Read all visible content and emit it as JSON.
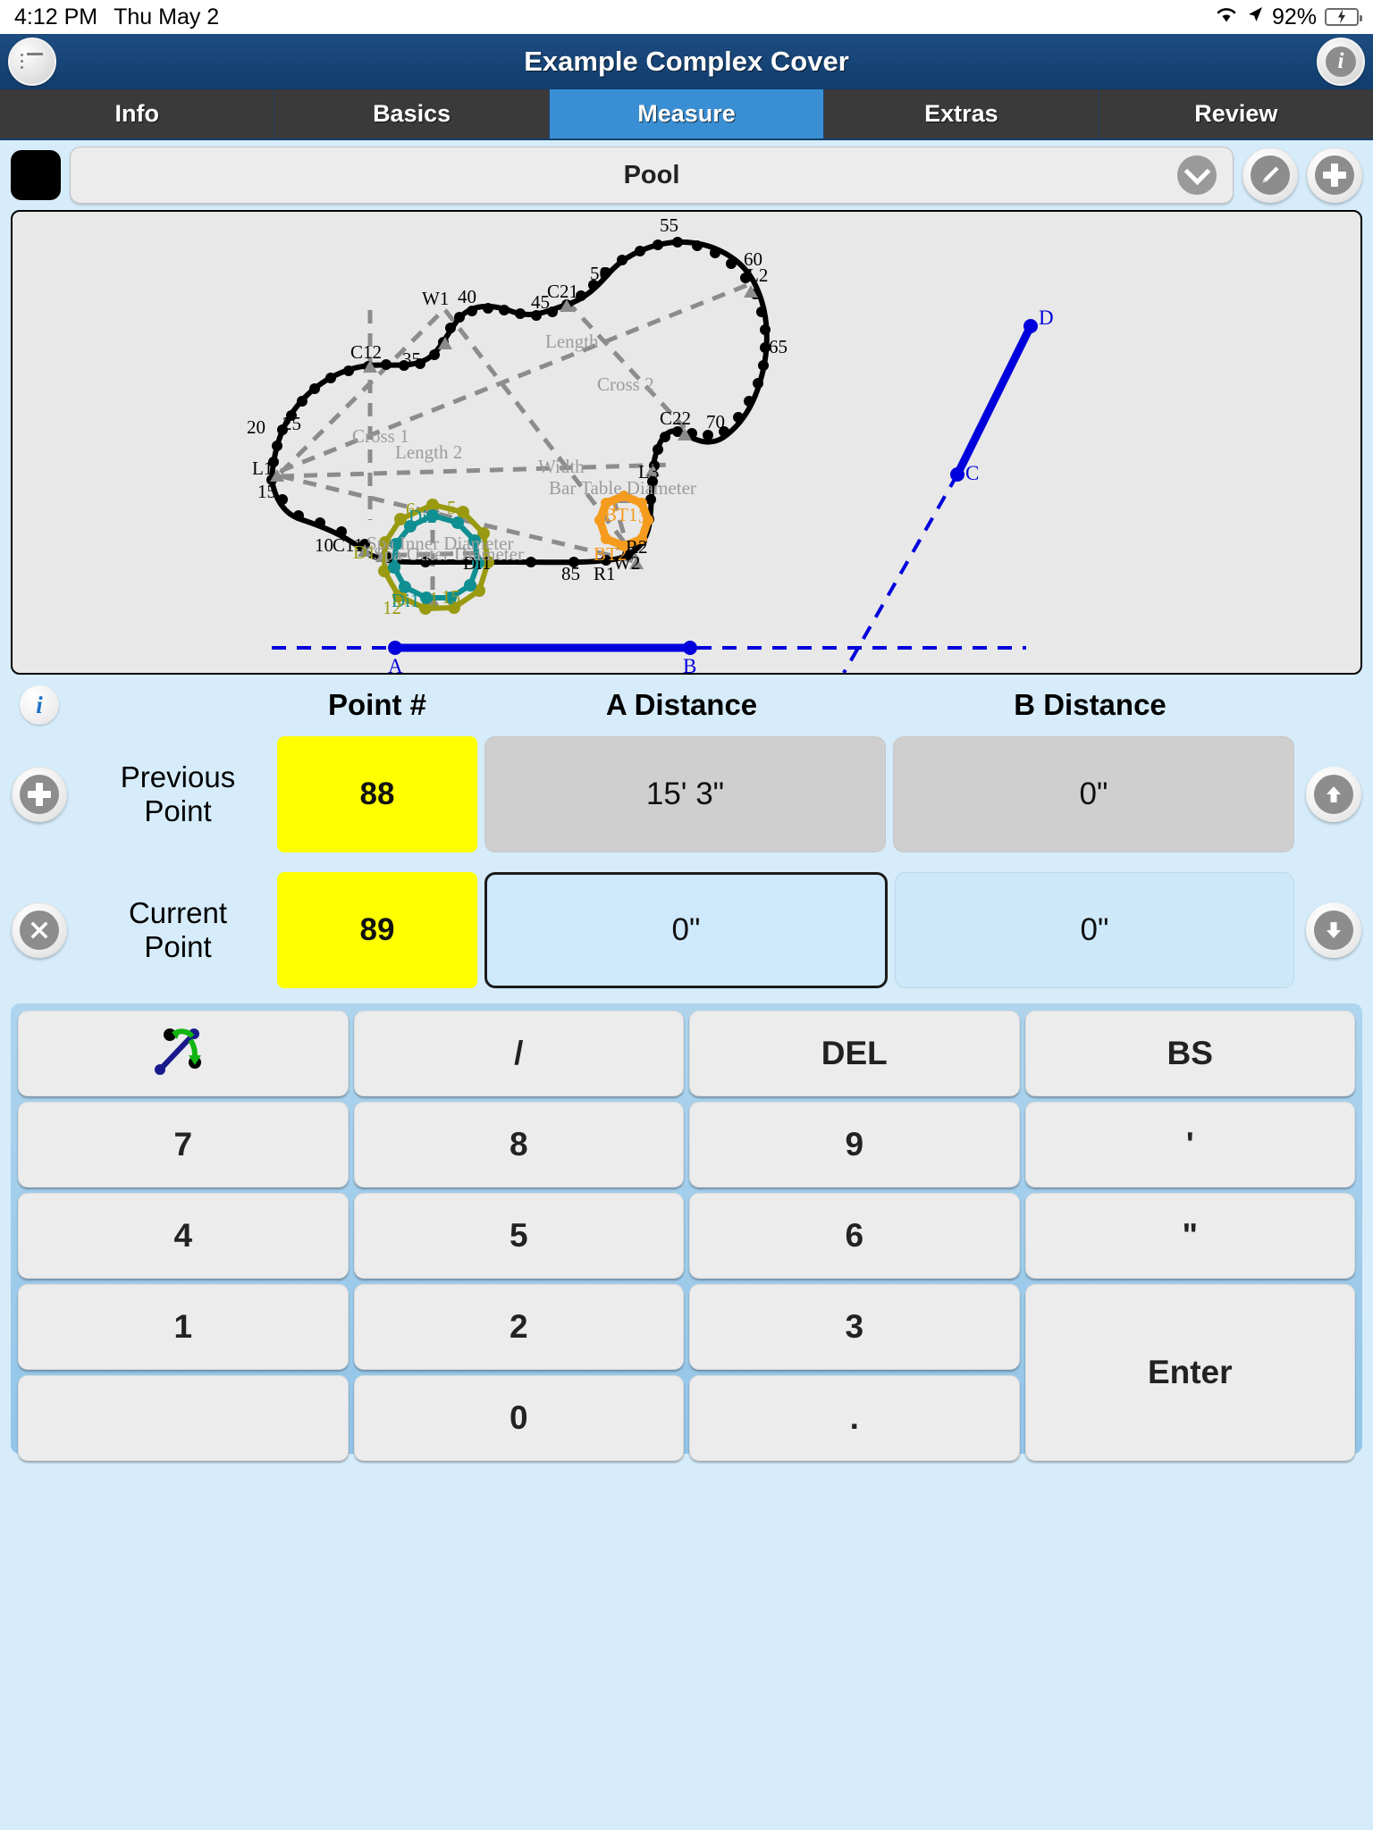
{
  "statusbar": {
    "time": "4:12 PM",
    "date": "Thu May 2",
    "battery_percent": "92%",
    "wifi_icon": "wifi-icon",
    "location_icon": "location-arrow-icon",
    "battery_icon": "battery-charging-icon"
  },
  "titlebar": {
    "title": "Example Complex Cover",
    "menu_icon": "list-menu-icon",
    "info_icon": "info-icon"
  },
  "tabs": [
    {
      "label": "Info",
      "active": false
    },
    {
      "label": "Basics",
      "active": false
    },
    {
      "label": "Measure",
      "active": true
    },
    {
      "label": "Extras",
      "active": false
    },
    {
      "label": "Review",
      "active": false
    }
  ],
  "selector": {
    "color_swatch": "#000000",
    "current_shape": "Pool",
    "chevron_icon": "chevron-down-icon",
    "edit_icon": "pencil-icon",
    "add_icon": "plus-icon"
  },
  "entry": {
    "info_icon": "info-icon",
    "add_icon": "plus-icon",
    "delete_icon": "close-x-icon",
    "up_icon": "arrow-up-icon",
    "down_icon": "arrow-down-icon",
    "columns": {
      "point": "Point #",
      "a": "A Distance",
      "b": "B Distance"
    },
    "rows": [
      {
        "label": "Previous\nPoint",
        "label_line1": "Previous",
        "label_line2": "Point",
        "point": "88",
        "a": "15' 3\"",
        "b": "0\"",
        "state": "readonly"
      },
      {
        "label": "Current\nPoint",
        "label_line1": "Current",
        "label_line2": "Point",
        "point": "89",
        "a": "0\"",
        "b": "0\"",
        "state": "editable"
      }
    ]
  },
  "keypad": [
    {
      "label": "",
      "name": "swap-points-button",
      "icon": "swap-arrows-icon"
    },
    {
      "label": "/",
      "name": "key-slash"
    },
    {
      "label": "DEL",
      "name": "key-del"
    },
    {
      "label": "BS",
      "name": "key-backspace"
    },
    {
      "label": "7",
      "name": "key-7"
    },
    {
      "label": "8",
      "name": "key-8"
    },
    {
      "label": "9",
      "name": "key-9"
    },
    {
      "label": "'",
      "name": "key-feet"
    },
    {
      "label": "4",
      "name": "key-4"
    },
    {
      "label": "5",
      "name": "key-5"
    },
    {
      "label": "6",
      "name": "key-6"
    },
    {
      "label": "\"",
      "name": "key-inches"
    },
    {
      "label": "1",
      "name": "key-1"
    },
    {
      "label": "2",
      "name": "key-2"
    },
    {
      "label": "3",
      "name": "key-3"
    },
    {
      "label": "Enter",
      "name": "key-enter"
    },
    {
      "label": "",
      "name": "key-blank"
    },
    {
      "label": "0",
      "name": "key-0"
    },
    {
      "label": ".",
      "name": "key-decimal"
    }
  ],
  "diagram": {
    "point_number_labels": [
      "10",
      "15",
      "20",
      "25",
      "35",
      "40",
      "45",
      "50",
      "55",
      "60",
      "65",
      "70",
      "85"
    ],
    "marker_labels": [
      "C11",
      "C12",
      "W1",
      "C21",
      "L2",
      "C22",
      "L3",
      "L1",
      "W2",
      "R1",
      "R2",
      "BT1",
      "BT2",
      "Di1",
      "Di2",
      "D1"
    ],
    "dimension_labels": [
      "Length",
      "Length 2",
      "Cross 1",
      "Cross 2",
      "Width",
      "Bar Table Diameter",
      "Spa Inner Diameter",
      "Spa Outer Diameter"
    ],
    "reference_points": [
      "A",
      "B",
      "C",
      "D"
    ],
    "colors": {
      "outline": "#000000",
      "dimension": "#8c8c8c",
      "reference_line": "#0000dd",
      "spa_inner": "#0f8f92",
      "spa_outer": "#9a9a11",
      "bar_table": "#f59b1d",
      "background": "#e8e8e8"
    },
    "spa_outer_numbers": [
      "1",
      "3",
      "5",
      "12",
      "15"
    ],
    "spa_inner_numbers": [
      "6"
    ],
    "bar_table_numbers": [
      "1",
      "3"
    ]
  }
}
